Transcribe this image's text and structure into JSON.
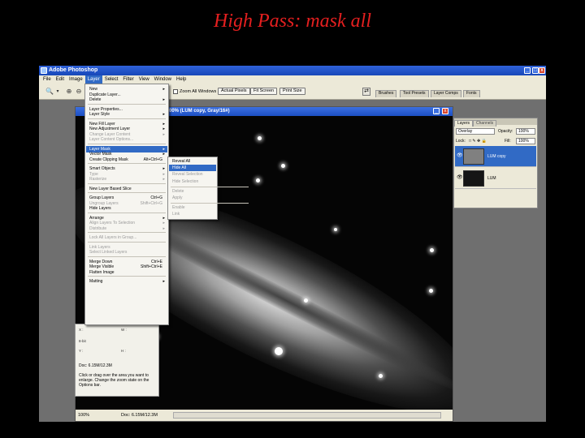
{
  "slide": {
    "title": "High Pass: mask all"
  },
  "app": {
    "title": "Adobe Photoshop",
    "menubar": [
      "File",
      "Edit",
      "Image",
      "Layer",
      "Select",
      "Filter",
      "View",
      "Window",
      "Help"
    ],
    "active_menu": "Layer"
  },
  "options": {
    "zoom_all_windows": "Zoom All Windows",
    "actual_pixels": "Actual Pixels",
    "fit_screen": "Fit Screen",
    "print_size": "Print Size",
    "wells": [
      "Brushes",
      "Tool Presets",
      "Layer Comps",
      "Fonts"
    ]
  },
  "document": {
    "title": "00% (LUM copy, Gray/16#)",
    "zoom": "100%",
    "doc_size": "Doc: 6.15M/12.3M"
  },
  "layer_menu": {
    "items": [
      {
        "label": "New",
        "arrow": true
      },
      {
        "label": "Duplicate Layer..."
      },
      {
        "label": "Delete",
        "arrow": true
      },
      {
        "sep": true
      },
      {
        "label": "Layer Properties..."
      },
      {
        "label": "Layer Style",
        "arrow": true
      },
      {
        "sep": true
      },
      {
        "label": "New Fill Layer",
        "arrow": true
      },
      {
        "label": "New Adjustment Layer",
        "arrow": true
      },
      {
        "label": "Change Layer Content",
        "arrow": true,
        "disabled": true
      },
      {
        "label": "Layer Content Options...",
        "disabled": true
      },
      {
        "sep": true
      },
      {
        "label": "Layer Mask",
        "arrow": true,
        "highlight": true
      },
      {
        "label": "Vector Mask",
        "arrow": true
      },
      {
        "label": "Create Clipping Mask",
        "shortcut": "Alt+Ctrl+G"
      },
      {
        "sep": true
      },
      {
        "label": "Smart Objects",
        "arrow": true
      },
      {
        "label": "Type",
        "arrow": true,
        "disabled": true
      },
      {
        "label": "Rasterize",
        "arrow": true,
        "disabled": true
      },
      {
        "sep": true
      },
      {
        "label": "New Layer Based Slice"
      },
      {
        "sep": true
      },
      {
        "label": "Group Layers",
        "shortcut": "Ctrl+G"
      },
      {
        "label": "Ungroup Layers",
        "shortcut": "Shift+Ctrl+G",
        "disabled": true
      },
      {
        "label": "Hide Layers"
      },
      {
        "sep": true
      },
      {
        "label": "Arrange",
        "arrow": true
      },
      {
        "label": "Align Layers To Selection",
        "arrow": true,
        "disabled": true
      },
      {
        "label": "Distribute",
        "arrow": true,
        "disabled": true
      },
      {
        "sep": true
      },
      {
        "label": "Lock All Layers in Group...",
        "disabled": true
      },
      {
        "sep": true
      },
      {
        "label": "Link Layers",
        "disabled": true
      },
      {
        "label": "Select Linked Layers",
        "disabled": true
      },
      {
        "sep": true
      },
      {
        "label": "Merge Down",
        "shortcut": "Ctrl+E"
      },
      {
        "label": "Merge Visible",
        "shortcut": "Shift+Ctrl+E"
      },
      {
        "label": "Flatten Image"
      },
      {
        "sep": true
      },
      {
        "label": "Matting",
        "arrow": true
      }
    ]
  },
  "layer_mask_submenu": {
    "items": [
      {
        "label": "Reveal All"
      },
      {
        "label": "Hide All",
        "highlight": true
      },
      {
        "label": "Reveal Selection",
        "disabled": true
      },
      {
        "label": "Hide Selection",
        "disabled": true
      },
      {
        "sep": true
      },
      {
        "label": "Delete",
        "disabled": true
      },
      {
        "label": "Apply",
        "disabled": true
      },
      {
        "sep": true
      },
      {
        "label": "Enable",
        "disabled": true
      },
      {
        "label": "Link",
        "disabled": true
      }
    ]
  },
  "info_panel": {
    "doc": "Doc: 6.15M/12.3M",
    "hint": "Click or drag over the area you want to enlarge. Change the zoom state on the Options bar.",
    "x_label": "X :",
    "y_label": "Y :",
    "w_label": "W :",
    "h_label": "H :",
    "k_label": "K :",
    "bit_label": "8-bit"
  },
  "layers_panel": {
    "tabs": [
      "Layers",
      "Channels"
    ],
    "blend_mode": "Overlay",
    "opacity_label": "Opacity:",
    "opacity": "100%",
    "lock_label": "Lock:",
    "fill_label": "Fill:",
    "fill": "100%",
    "layers": [
      {
        "name": "LUM copy",
        "active": true
      },
      {
        "name": "LUM",
        "active": false
      }
    ]
  },
  "colors": {
    "slide_title": "#e41f1f",
    "menu_highlight": "#316ac5",
    "titlebar": "#1f4fc5"
  }
}
